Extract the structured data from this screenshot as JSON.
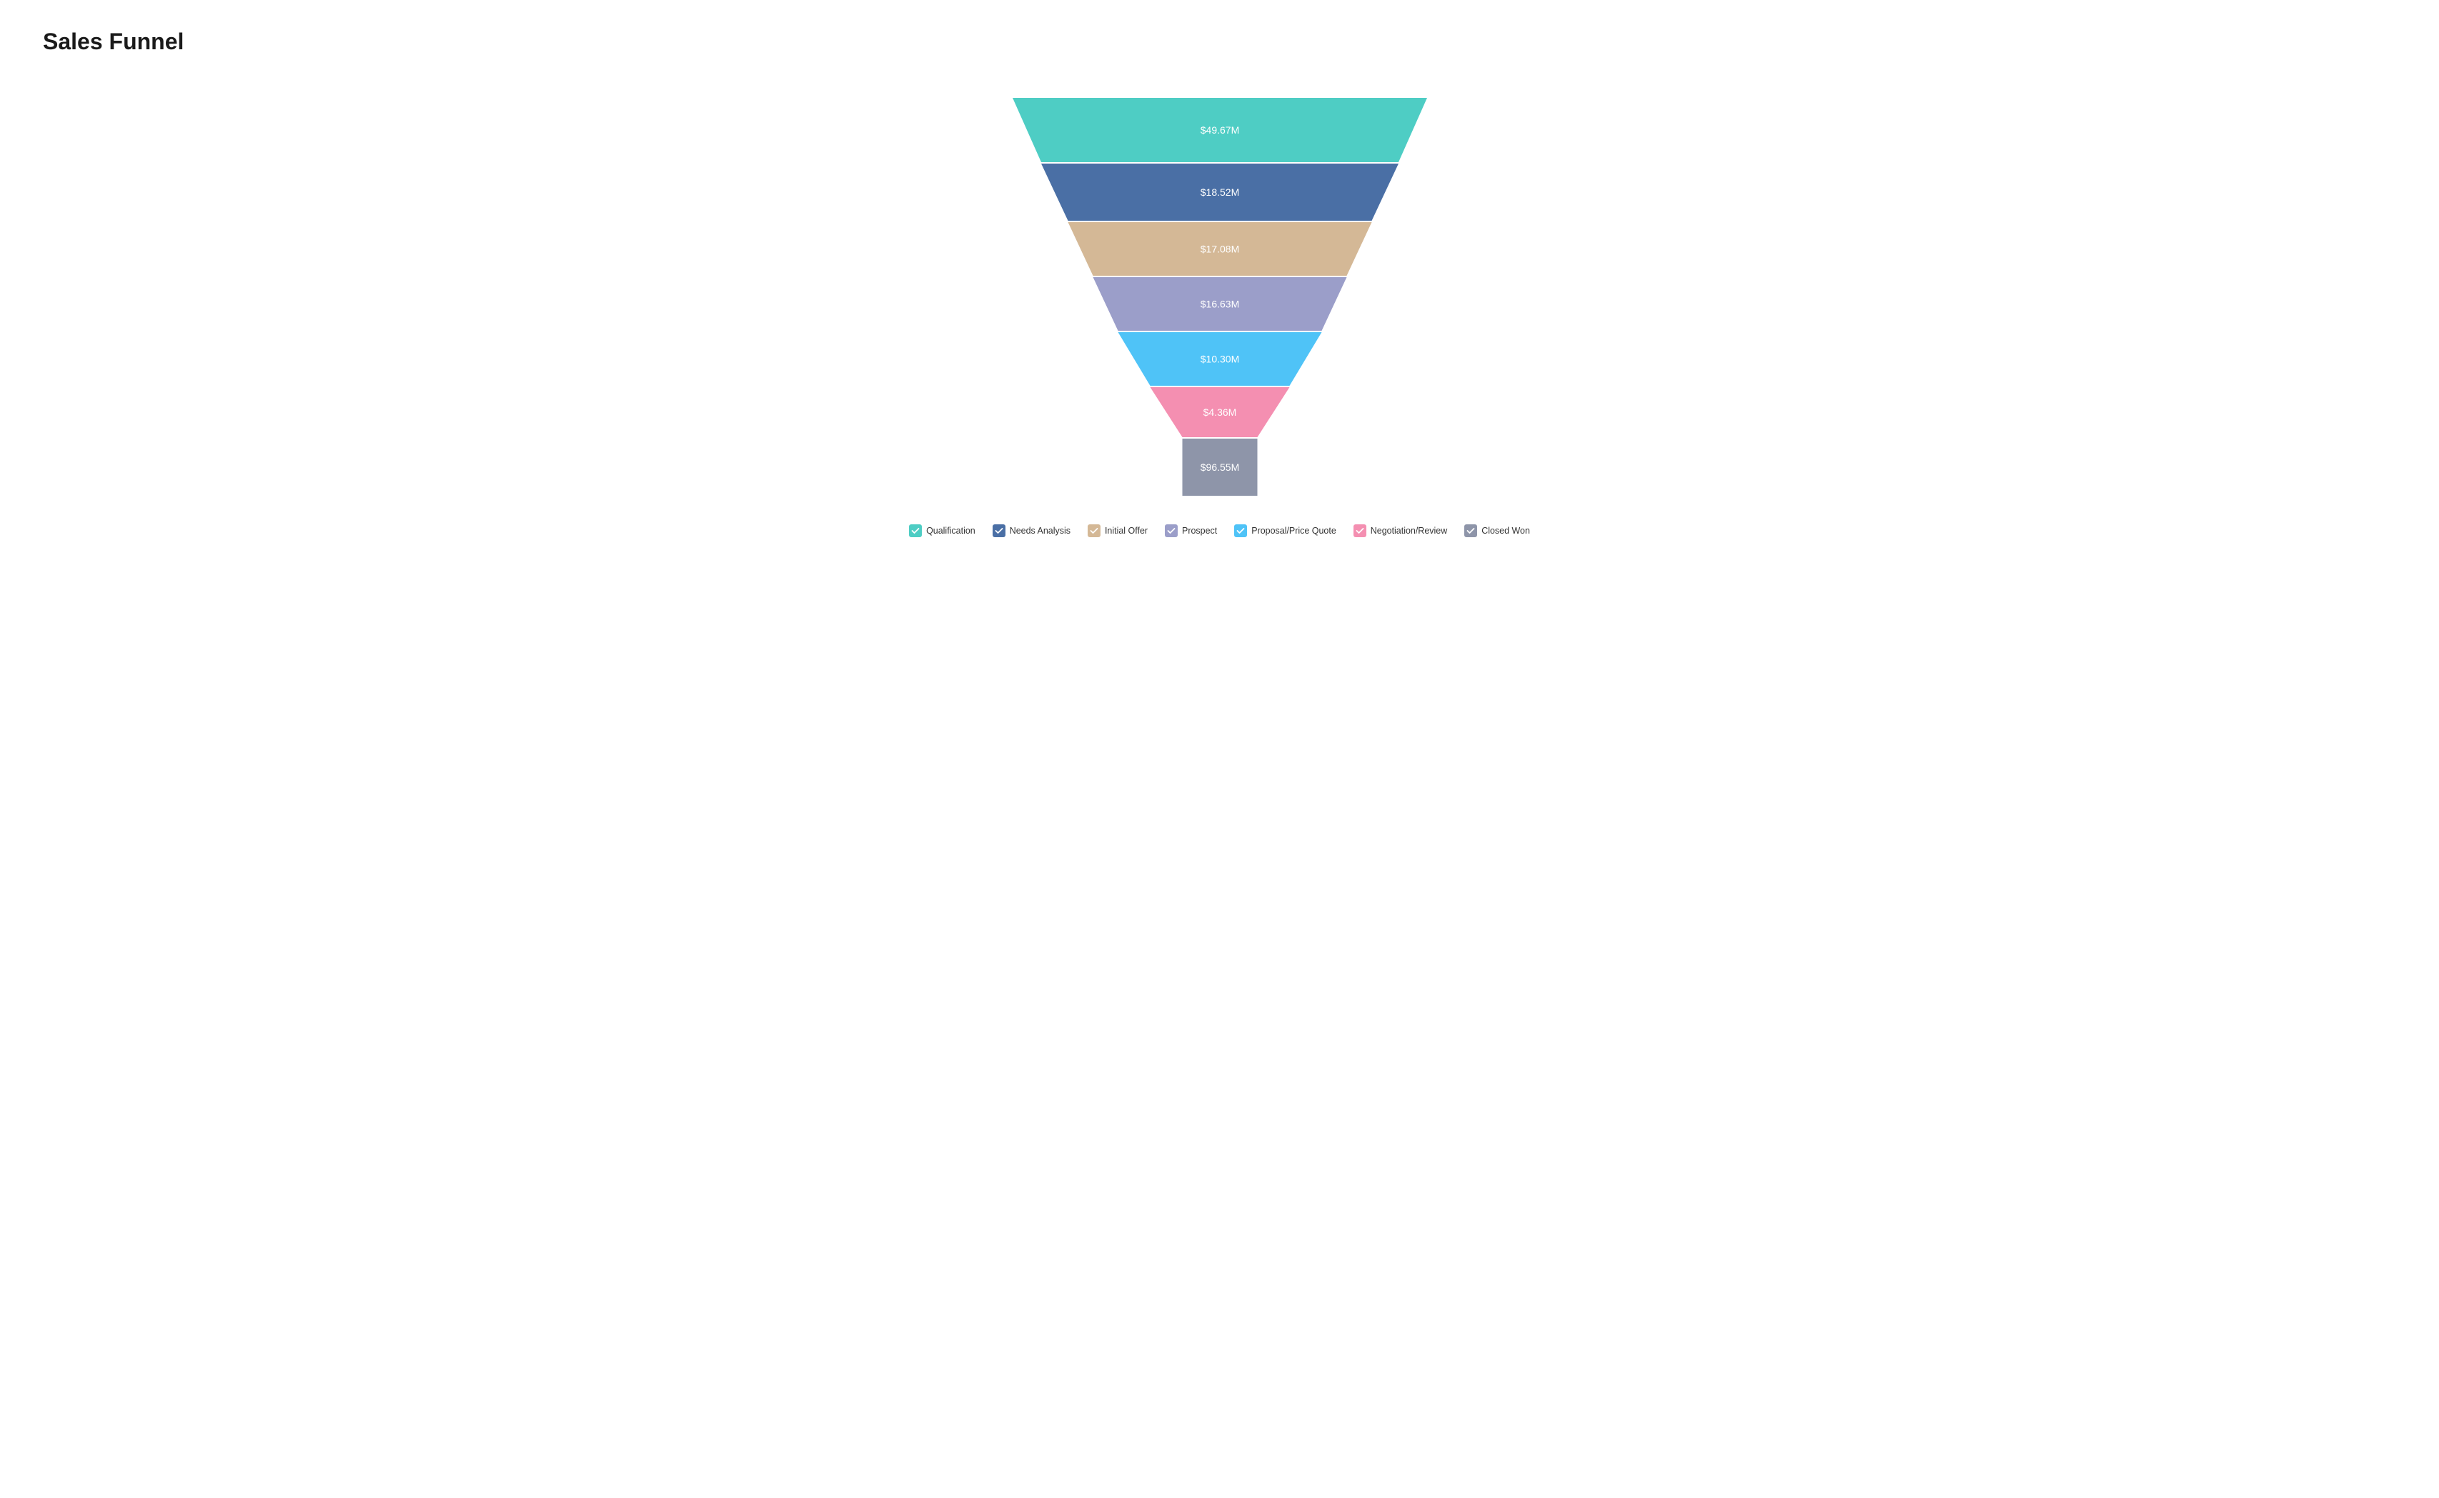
{
  "title": "Sales Funnel",
  "funnel": {
    "segments": [
      {
        "id": "qualification",
        "label": "$49.67M",
        "color": "#4ECDC4",
        "widthTop": 580,
        "widthBottom": 500,
        "height": 90
      },
      {
        "id": "needs-analysis",
        "label": "$18.52M",
        "color": "#4A6FA5",
        "widthTop": 500,
        "widthBottom": 425,
        "height": 80
      },
      {
        "id": "initial-offer",
        "label": "$17.08M",
        "color": "#D4B896",
        "widthTop": 425,
        "widthBottom": 355,
        "height": 75
      },
      {
        "id": "prospect",
        "label": "$16.63M",
        "color": "#9B9EC9",
        "widthTop": 355,
        "widthBottom": 285,
        "height": 75
      },
      {
        "id": "proposal-price-quote",
        "label": "$10.30M",
        "color": "#4FC3F7",
        "widthTop": 285,
        "widthBottom": 195,
        "height": 75
      },
      {
        "id": "negotiation-review",
        "label": "$4.36M",
        "color": "#F48FB1",
        "widthTop": 195,
        "widthBottom": 105,
        "height": 70
      },
      {
        "id": "closed-won",
        "label": "$96.55M",
        "color": "#8E95A9",
        "widthTop": 105,
        "widthBottom": 105,
        "height": 80
      }
    ]
  },
  "legend": {
    "items": [
      {
        "id": "qualification",
        "label": "Qualification",
        "color": "#4ECDC4"
      },
      {
        "id": "needs-analysis",
        "label": "Needs Analysis",
        "color": "#4A6FA5"
      },
      {
        "id": "initial-offer",
        "label": "Initial Offer",
        "color": "#D4B896"
      },
      {
        "id": "prospect",
        "label": "Prospect",
        "color": "#9B9EC9"
      },
      {
        "id": "proposal-price-quote",
        "label": "Proposal/Price Quote",
        "color": "#4FC3F7"
      },
      {
        "id": "negotiation-review",
        "label": "Negotiation/Review",
        "color": "#F48FB1"
      },
      {
        "id": "closed-won",
        "label": "Closed Won",
        "color": "#8E95A9"
      }
    ]
  }
}
